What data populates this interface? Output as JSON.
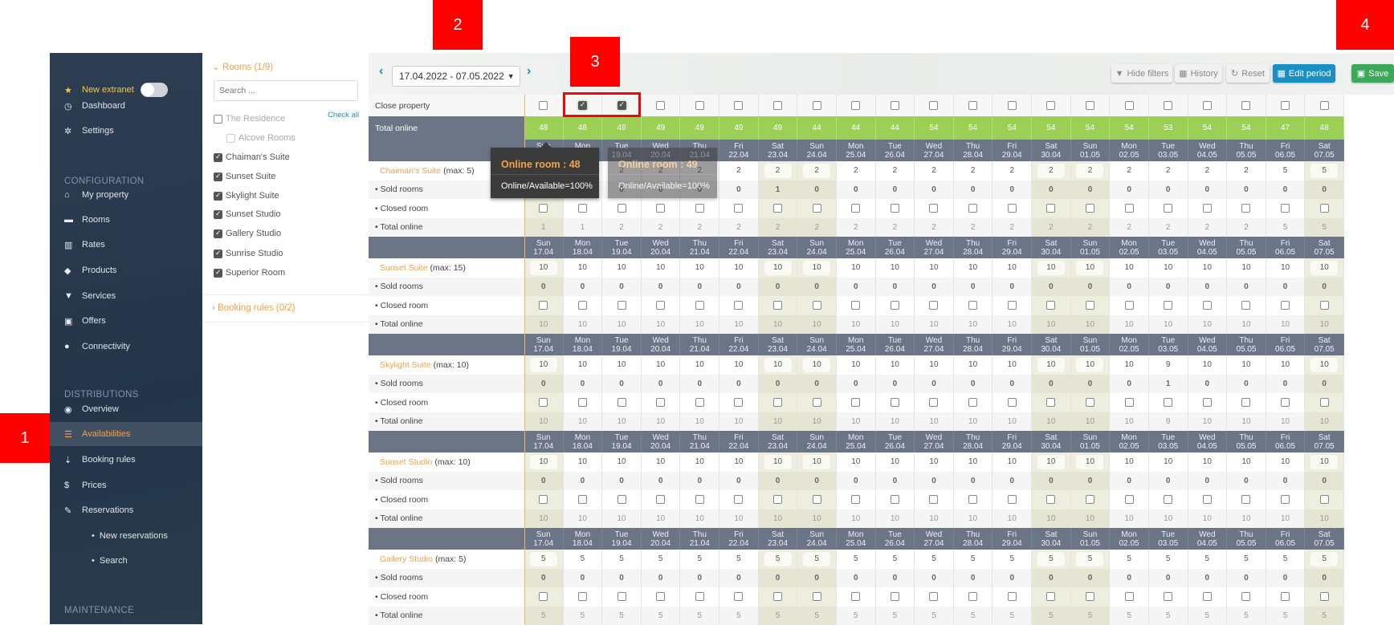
{
  "sidebar": {
    "new_extranet": "New extranet",
    "sections": {
      "configuration": "CONFIGURATION",
      "distributions": "DISTRIBUTIONS",
      "maintenance": "MAINTENANCE"
    },
    "items": [
      {
        "label": "Dashboard",
        "icon": "dashboard-icon",
        "glyph": "◷"
      },
      {
        "label": "Settings",
        "icon": "gear-icon",
        "glyph": "✲"
      },
      {
        "label": "My property",
        "icon": "home-icon",
        "glyph": "⌂"
      },
      {
        "label": "Rooms",
        "icon": "bed-icon",
        "glyph": "▬"
      },
      {
        "label": "Rates",
        "icon": "barcode-icon",
        "glyph": "▥"
      },
      {
        "label": "Products",
        "icon": "tags-icon",
        "glyph": "◆"
      },
      {
        "label": "Services",
        "icon": "cart-icon",
        "glyph": "▼"
      },
      {
        "label": "Offers",
        "icon": "gift-icon",
        "glyph": "▣"
      },
      {
        "label": "Connectivity",
        "icon": "globe-icon",
        "glyph": "●"
      },
      {
        "label": "Overview",
        "icon": "eye-icon",
        "glyph": "◉"
      },
      {
        "label": "Availabilities",
        "icon": "list-icon",
        "glyph": "☰",
        "active": true
      },
      {
        "label": "Booking rules",
        "icon": "sort-icon",
        "glyph": "⇣"
      },
      {
        "label": "Prices",
        "icon": "dollar-icon",
        "glyph": "$"
      },
      {
        "label": "Reservations",
        "icon": "pin-icon",
        "glyph": "✎"
      },
      {
        "label": "New reservations",
        "sub": true
      },
      {
        "label": "Search",
        "sub": true
      }
    ]
  },
  "filters": {
    "rooms_title": "Rooms (1/9)",
    "search_placeholder": "Search ...",
    "check_all": "Check all",
    "rooms": [
      {
        "label": "The Residence",
        "checked": false
      },
      {
        "label": "Alcove Rooms",
        "checked": false,
        "indent": true,
        "disabled": true
      },
      {
        "label": "Chaiman's Suite",
        "checked": true
      },
      {
        "label": "Sunset Suite",
        "checked": true
      },
      {
        "label": "Skylight Suite",
        "checked": true
      },
      {
        "label": "Sunset Studio",
        "checked": true
      },
      {
        "label": "Gallery Studio",
        "checked": true
      },
      {
        "label": "Sunrise Studio",
        "checked": true
      },
      {
        "label": "Superior Room",
        "checked": true
      }
    ],
    "booking_rules_title": "Booking rules (0/2)"
  },
  "toolbar": {
    "date_range": "17.04.2022 - 07.05.2022",
    "hide_filters": "Hide filters",
    "history": "History",
    "reset": "Reset",
    "edit_period": "Edit period",
    "save": "Save"
  },
  "grid": {
    "close_property_label": "Close property",
    "total_online_label": "Total online",
    "sold_label": "• Sold rooms",
    "closed_label": "• Closed room",
    "total_label": "• Total online",
    "max_prefix": "(max: ",
    "days": [
      [
        "Sun",
        "17.04"
      ],
      [
        "Mon",
        "18.04"
      ],
      [
        "Tue",
        "19.04"
      ],
      [
        "Wed",
        "20.04"
      ],
      [
        "Thu",
        "21.04"
      ],
      [
        "Fri",
        "22.04"
      ],
      [
        "Sat",
        "23.04"
      ],
      [
        "Sun",
        "24.04"
      ],
      [
        "Mon",
        "25.04"
      ],
      [
        "Tue",
        "26.04"
      ],
      [
        "Wed",
        "27.04"
      ],
      [
        "Thu",
        "28.04"
      ],
      [
        "Fri",
        "29.04"
      ],
      [
        "Sat",
        "30.04"
      ],
      [
        "Sun",
        "01.05"
      ],
      [
        "Mon",
        "02.05"
      ],
      [
        "Tue",
        "03.05"
      ],
      [
        "Wed",
        "04.05"
      ],
      [
        "Thu",
        "05.05"
      ],
      [
        "Fri",
        "06.05"
      ],
      [
        "Sat",
        "07.05"
      ]
    ],
    "close_property": [
      false,
      true,
      true,
      false,
      false,
      false,
      false,
      false,
      false,
      false,
      false,
      false,
      false,
      false,
      false,
      false,
      false,
      false,
      false,
      false,
      false
    ],
    "total_online": [
      48,
      48,
      49,
      49,
      49,
      49,
      49,
      44,
      44,
      44,
      54,
      54,
      54,
      54,
      54,
      54,
      53,
      54,
      54,
      47,
      48
    ],
    "rooms": [
      {
        "name": "Chaiman's Suite",
        "max": 5,
        "online": [
          1,
          1,
          2,
          2,
          2,
          2,
          2,
          2,
          2,
          2,
          2,
          2,
          2,
          2,
          2,
          2,
          2,
          2,
          2,
          5,
          5
        ],
        "sold": [
          0,
          0,
          0,
          0,
          0,
          0,
          1,
          0,
          0,
          0,
          0,
          0,
          0,
          0,
          0,
          0,
          0,
          0,
          0,
          0,
          0
        ],
        "total": [
          1,
          1,
          2,
          2,
          2,
          2,
          2,
          2,
          2,
          2,
          2,
          2,
          2,
          2,
          2,
          2,
          2,
          2,
          2,
          5,
          5
        ]
      },
      {
        "name": "Sunset Suite",
        "max": 15,
        "online": [
          10,
          10,
          10,
          10,
          10,
          10,
          10,
          10,
          10,
          10,
          10,
          10,
          10,
          10,
          10,
          10,
          10,
          10,
          10,
          10,
          10
        ],
        "sold": [
          0,
          0,
          0,
          0,
          0,
          0,
          0,
          0,
          0,
          0,
          0,
          0,
          0,
          0,
          0,
          0,
          0,
          0,
          0,
          0,
          0
        ],
        "total": [
          10,
          10,
          10,
          10,
          10,
          10,
          10,
          10,
          10,
          10,
          10,
          10,
          10,
          10,
          10,
          10,
          10,
          10,
          10,
          10,
          10
        ]
      },
      {
        "name": "Skylight Suite",
        "max": 10,
        "online": [
          10,
          10,
          10,
          10,
          10,
          10,
          10,
          10,
          10,
          10,
          10,
          10,
          10,
          10,
          10,
          10,
          9,
          10,
          10,
          10,
          10
        ],
        "sold": [
          0,
          0,
          0,
          0,
          0,
          0,
          0,
          0,
          0,
          0,
          0,
          0,
          0,
          0,
          0,
          0,
          1,
          0,
          0,
          0,
          0
        ],
        "total": [
          10,
          10,
          10,
          10,
          10,
          10,
          10,
          10,
          10,
          10,
          10,
          10,
          10,
          10,
          10,
          10,
          9,
          10,
          10,
          10,
          10
        ]
      },
      {
        "name": "Sunset Studio",
        "max": 10,
        "online": [
          10,
          10,
          10,
          10,
          10,
          10,
          10,
          10,
          10,
          10,
          10,
          10,
          10,
          10,
          10,
          10,
          10,
          10,
          10,
          10,
          10
        ],
        "sold": [
          0,
          0,
          0,
          0,
          0,
          0,
          0,
          0,
          0,
          0,
          0,
          0,
          0,
          0,
          0,
          0,
          0,
          0,
          0,
          0,
          0
        ],
        "total": [
          10,
          10,
          10,
          10,
          10,
          10,
          10,
          10,
          10,
          10,
          10,
          10,
          10,
          10,
          10,
          10,
          10,
          10,
          10,
          10,
          10
        ]
      },
      {
        "name": "Gallery Studio",
        "max": 5,
        "online": [
          5,
          5,
          5,
          5,
          5,
          5,
          5,
          5,
          5,
          5,
          5,
          5,
          5,
          5,
          5,
          5,
          5,
          5,
          5,
          5,
          5
        ],
        "sold": [
          0,
          0,
          0,
          0,
          0,
          0,
          0,
          0,
          0,
          0,
          0,
          0,
          0,
          0,
          0,
          0,
          0,
          0,
          0,
          0,
          0
        ],
        "total": [
          5,
          5,
          5,
          5,
          5,
          5,
          5,
          5,
          5,
          5,
          5,
          5,
          5,
          5,
          5,
          5,
          5,
          5,
          5,
          5,
          5
        ]
      }
    ]
  },
  "tooltips": [
    {
      "title": "Online room : 48",
      "body": "Online/Available=100%"
    },
    {
      "title": "Online room : 49",
      "body": "Online/Available=100%"
    }
  ],
  "markers": [
    "1",
    "2",
    "3",
    "4"
  ],
  "colors": {
    "accent": "#f3a24c",
    "total_online": "#9ccf55",
    "header": "#6b7585",
    "edit_button": "#1a8fc4",
    "save_button": "#3aa95a",
    "marker": "#ff0000"
  }
}
